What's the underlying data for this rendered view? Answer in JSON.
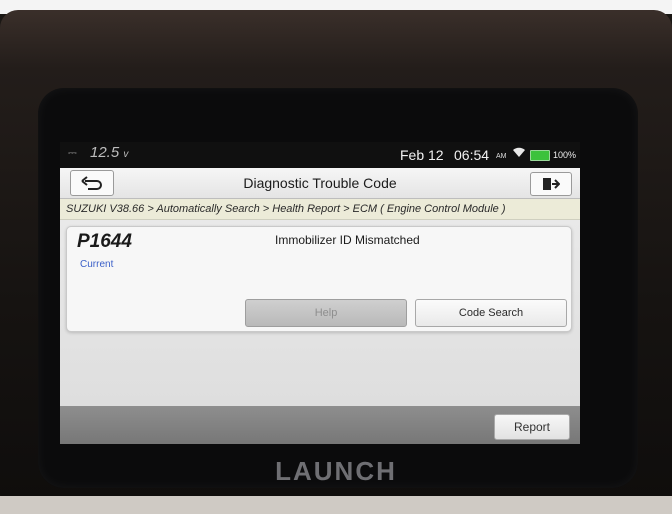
{
  "status_bar": {
    "voltage_icon": "⎓",
    "voltage": "12.5",
    "voltage_unit": "v",
    "date": "Feb 12",
    "time": "06:54",
    "ampm": "AM",
    "wifi_icon": "wifi-icon",
    "battery_icon": "battery-icon",
    "battery_level": 100,
    "battery": "100%"
  },
  "header": {
    "title": "Diagnostic Trouble Code",
    "back_icon": "back-arrow-icon",
    "exit_icon": "exit-icon"
  },
  "breadcrumb": "SUZUKI V38.66 > Automatically Search > Health Report > ECM ( Engine Control Module )",
  "dtc": {
    "code": "P1644",
    "status": "Current",
    "description": "Immobilizer ID Mismatched",
    "buttons": {
      "help": "Help",
      "code_search": "Code Search"
    }
  },
  "footer": {
    "report": "Report"
  },
  "device": {
    "brand": "LAUNCH"
  },
  "colors": {
    "status_bar_bg": "#101010",
    "breadcrumb_bg": "#ecebd8",
    "status_text": "#3a5fc8",
    "battery": "#3cc23c",
    "footer_bg": "#808080"
  }
}
